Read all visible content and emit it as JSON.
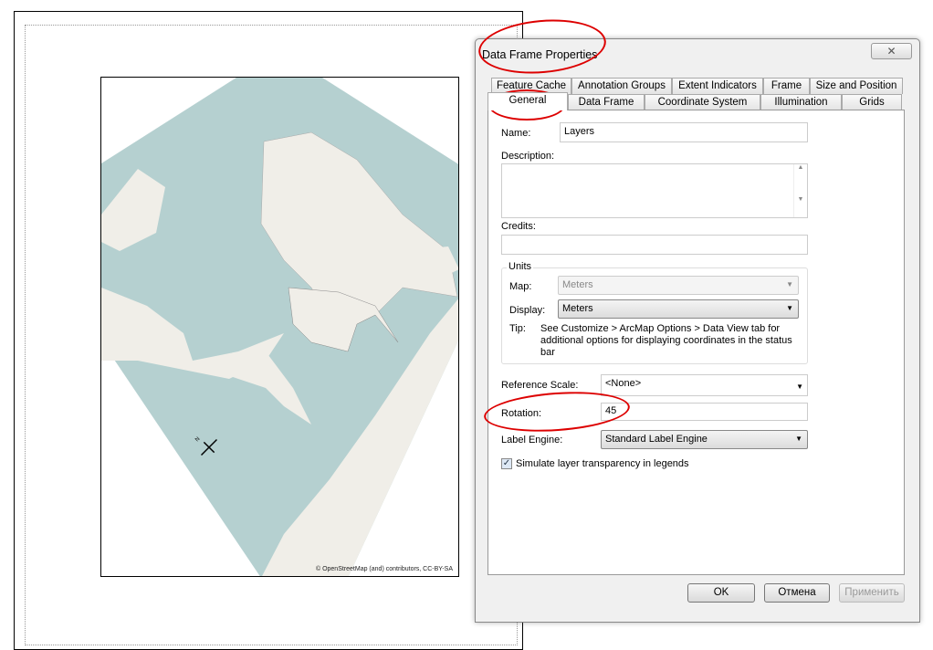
{
  "layout": {
    "attribution": "© OpenStreetMap (and) contributors, CC-BY-SA",
    "north_arrow_label": "N"
  },
  "dialog": {
    "title": "Data Frame Properties",
    "close_icon": "close-icon",
    "tabs_row1": [
      "Feature Cache",
      "Annotation Groups",
      "Extent Indicators",
      "Frame",
      "Size and Position"
    ],
    "tabs_row2": [
      "General",
      "Data Frame",
      "Coordinate System",
      "Illumination",
      "Grids"
    ],
    "active_tab": "General",
    "general": {
      "name_label": "Name:",
      "name_value": "Layers",
      "description_label": "Description:",
      "description_value": "",
      "credits_label": "Credits:",
      "credits_value": "",
      "units_group": "Units",
      "map_label": "Map:",
      "map_value": "Meters",
      "display_label": "Display:",
      "display_value": "Meters",
      "tip_label": "Tip:",
      "tip_text": "See Customize > ArcMap Options > Data View tab for additional options for displaying coordinates in the status bar",
      "reference_scale_label": "Reference Scale:",
      "reference_scale_value": "<None>",
      "rotation_label": "Rotation:",
      "rotation_value": "45",
      "label_engine_label": "Label Engine:",
      "label_engine_value": "Standard Label Engine",
      "simulate_transparency_label": "Simulate layer transparency in legends",
      "simulate_transparency_checked": true
    },
    "buttons": {
      "ok": "OK",
      "cancel": "Отмена",
      "apply": "Применить"
    }
  },
  "colors": {
    "water": "#b5d0d0",
    "land": "#f0eee8",
    "annotation": "#dd0000"
  }
}
